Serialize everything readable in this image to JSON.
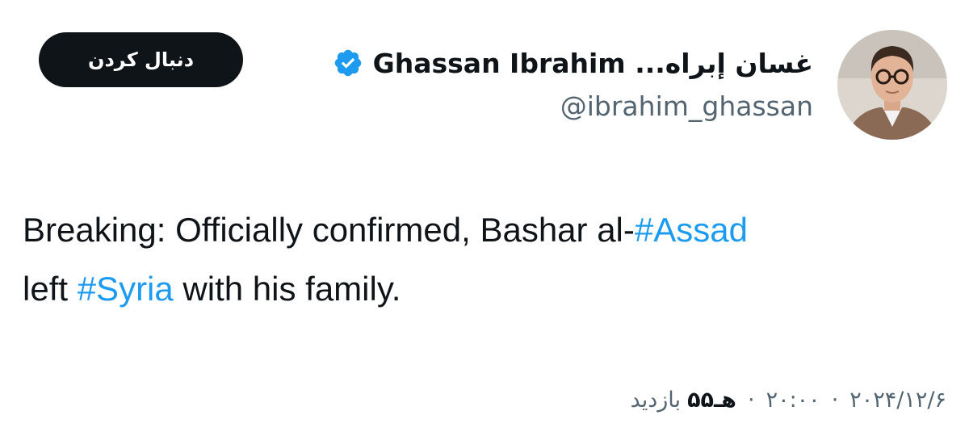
{
  "user": {
    "display_name": "غسان إبراه... Ghassan Ibrahim",
    "handle": "@ibrahim_ghassan",
    "verified_icon": "verified-badge-icon",
    "avatar_icon": "avatar-photo"
  },
  "follow_button": {
    "label": "دنبال کردن"
  },
  "tweet": {
    "line1_prefix": "Breaking: Officially confirmed, Bashar al-",
    "line1_hashtag": "#Assad",
    "line2_prefix": "left ",
    "line2_hashtag": "#Syria",
    "line2_suffix": " with his family."
  },
  "meta": {
    "date": "۲۰۲۴/۱۲/۶",
    "time": "۲۰:۰۰",
    "separator": "·",
    "views_count": "۵۵هـ",
    "views_label": "بازدید"
  },
  "colors": {
    "hashtag": "#1d9bf0",
    "verified": "#1d9bf0",
    "button_bg": "#0f1419",
    "secondary_text": "#536471"
  }
}
